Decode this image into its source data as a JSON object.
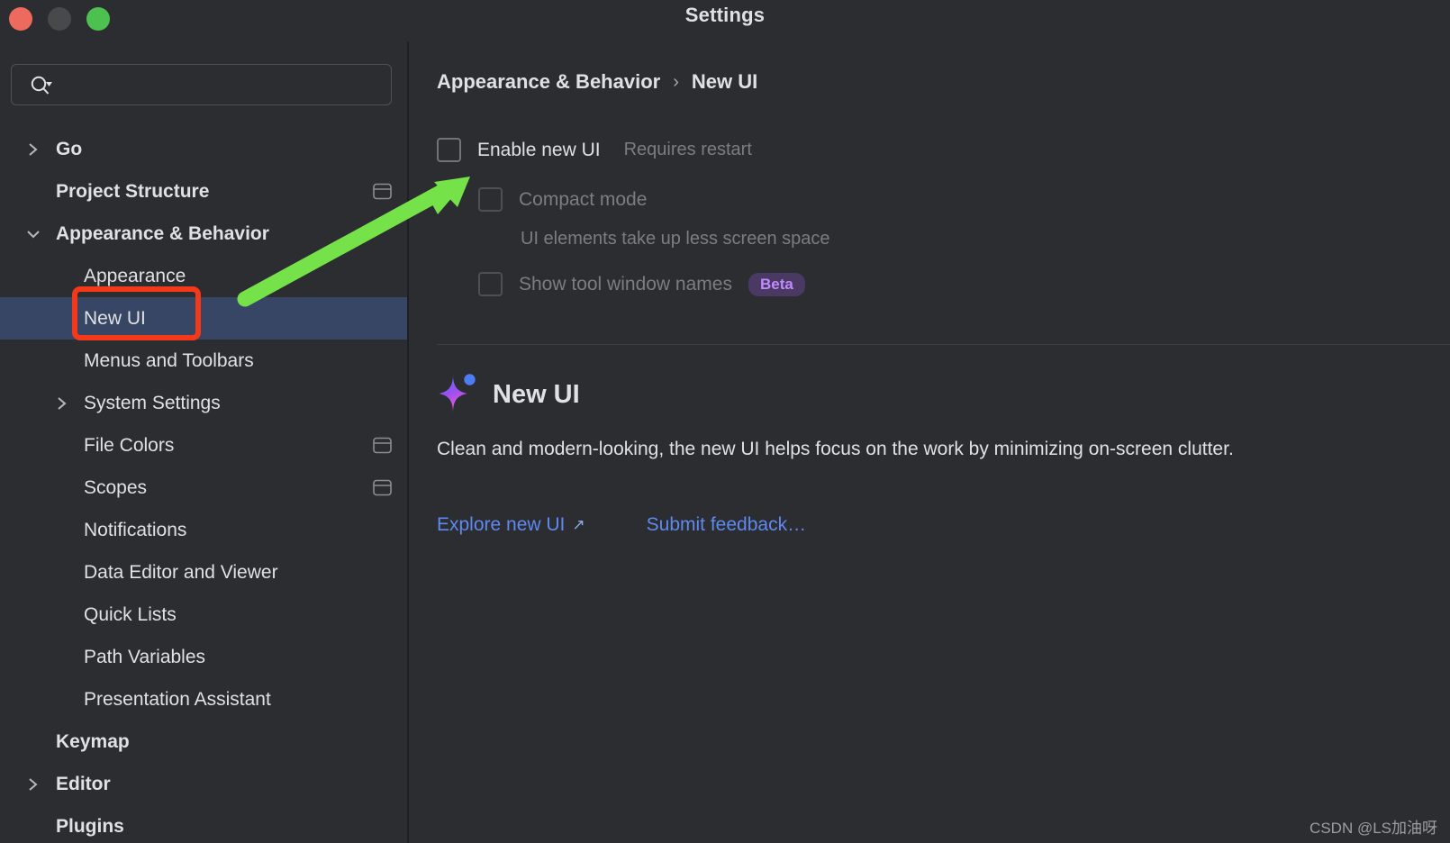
{
  "window": {
    "title": "Settings",
    "controls": [
      "close-button",
      "minimize-button",
      "maximize-button"
    ]
  },
  "search": {
    "value": "",
    "placeholder": "",
    "icon": "search-icon"
  },
  "sidebar": {
    "items": [
      {
        "label": "Go",
        "level": 0,
        "bold": true,
        "arrow": "right",
        "scope_icon": false,
        "selected": false
      },
      {
        "label": "Project Structure",
        "level": 0,
        "bold": true,
        "arrow": "none",
        "scope_icon": true,
        "selected": false
      },
      {
        "label": "Appearance & Behavior",
        "level": 0,
        "bold": true,
        "arrow": "down",
        "scope_icon": false,
        "selected": false
      },
      {
        "label": "Appearance",
        "level": 1,
        "bold": false,
        "arrow": "none",
        "scope_icon": false,
        "selected": false
      },
      {
        "label": "New UI",
        "level": 1,
        "bold": false,
        "arrow": "none",
        "scope_icon": false,
        "selected": true
      },
      {
        "label": "Menus and Toolbars",
        "level": 1,
        "bold": false,
        "arrow": "none",
        "scope_icon": false,
        "selected": false
      },
      {
        "label": "System Settings",
        "level": 1,
        "bold": false,
        "arrow": "right",
        "scope_icon": false,
        "selected": false
      },
      {
        "label": "File Colors",
        "level": 1,
        "bold": false,
        "arrow": "none",
        "scope_icon": true,
        "selected": false
      },
      {
        "label": "Scopes",
        "level": 1,
        "bold": false,
        "arrow": "none",
        "scope_icon": true,
        "selected": false
      },
      {
        "label": "Notifications",
        "level": 1,
        "bold": false,
        "arrow": "none",
        "scope_icon": false,
        "selected": false
      },
      {
        "label": "Data Editor and Viewer",
        "level": 1,
        "bold": false,
        "arrow": "none",
        "scope_icon": false,
        "selected": false
      },
      {
        "label": "Quick Lists",
        "level": 1,
        "bold": false,
        "arrow": "none",
        "scope_icon": false,
        "selected": false
      },
      {
        "label": "Path Variables",
        "level": 1,
        "bold": false,
        "arrow": "none",
        "scope_icon": false,
        "selected": false
      },
      {
        "label": "Presentation Assistant",
        "level": 1,
        "bold": false,
        "arrow": "none",
        "scope_icon": false,
        "selected": false
      },
      {
        "label": "Keymap",
        "level": 0,
        "bold": true,
        "arrow": "none",
        "scope_icon": false,
        "selected": false
      },
      {
        "label": "Editor",
        "level": 0,
        "bold": true,
        "arrow": "right",
        "scope_icon": false,
        "selected": false
      },
      {
        "label": "Plugins",
        "level": 0,
        "bold": true,
        "arrow": "none",
        "scope_icon": false,
        "selected": false
      }
    ]
  },
  "breadcrumb": {
    "parent": "Appearance & Behavior",
    "separator": "›",
    "current": "New UI"
  },
  "options": {
    "enable_new_ui": {
      "label": "Enable new UI",
      "note": "Requires restart",
      "checked": false,
      "enabled": true
    },
    "compact_mode": {
      "label": "Compact mode",
      "description": "UI elements take up less screen space",
      "checked": false,
      "enabled": false
    },
    "show_tool_window_names": {
      "label": "Show tool window names",
      "badge": "Beta",
      "checked": false,
      "enabled": false
    }
  },
  "promo": {
    "icon": "sparkle-icon",
    "title": "New UI",
    "description": "Clean and modern-looking, the new UI helps focus on the work by minimizing on-screen clutter.",
    "links": [
      {
        "label": "Explore new UI",
        "external": true,
        "external_glyph": "↗"
      },
      {
        "label": "Submit feedback…",
        "external": false,
        "external_glyph": ""
      }
    ]
  },
  "annotations": {
    "highlight_box_target": "New UI",
    "arrow_color": "#76e martine",
    "colors": {
      "highlight_box": "#f4391b",
      "arrow": "#76e24a",
      "selection": "#374665",
      "link": "#5f89f0",
      "beta_bg": "#4a3a63",
      "beta_text": "#c08aff"
    }
  },
  "watermark": {
    "text": "CSDN @LS加油呀"
  }
}
